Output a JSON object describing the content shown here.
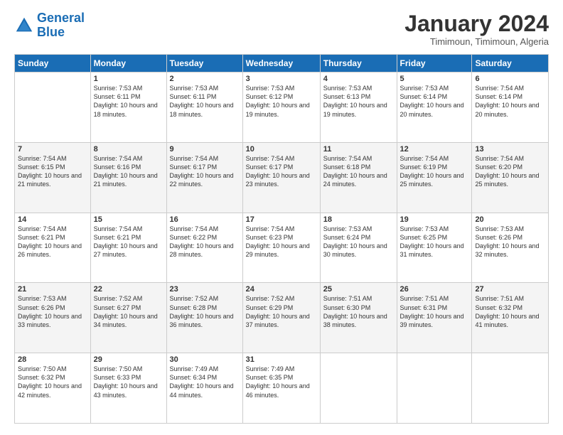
{
  "header": {
    "logo_line1": "General",
    "logo_line2": "Blue",
    "month_title": "January 2024",
    "subtitle": "Timimoun, Timimoun, Algeria"
  },
  "days_of_week": [
    "Sunday",
    "Monday",
    "Tuesday",
    "Wednesday",
    "Thursday",
    "Friday",
    "Saturday"
  ],
  "weeks": [
    [
      {
        "num": "",
        "sunrise": "",
        "sunset": "",
        "daylight": "",
        "empty": true
      },
      {
        "num": "1",
        "sunrise": "Sunrise: 7:53 AM",
        "sunset": "Sunset: 6:11 PM",
        "daylight": "Daylight: 10 hours and 18 minutes."
      },
      {
        "num": "2",
        "sunrise": "Sunrise: 7:53 AM",
        "sunset": "Sunset: 6:11 PM",
        "daylight": "Daylight: 10 hours and 18 minutes."
      },
      {
        "num": "3",
        "sunrise": "Sunrise: 7:53 AM",
        "sunset": "Sunset: 6:12 PM",
        "daylight": "Daylight: 10 hours and 19 minutes."
      },
      {
        "num": "4",
        "sunrise": "Sunrise: 7:53 AM",
        "sunset": "Sunset: 6:13 PM",
        "daylight": "Daylight: 10 hours and 19 minutes."
      },
      {
        "num": "5",
        "sunrise": "Sunrise: 7:53 AM",
        "sunset": "Sunset: 6:14 PM",
        "daylight": "Daylight: 10 hours and 20 minutes."
      },
      {
        "num": "6",
        "sunrise": "Sunrise: 7:54 AM",
        "sunset": "Sunset: 6:14 PM",
        "daylight": "Daylight: 10 hours and 20 minutes."
      }
    ],
    [
      {
        "num": "7",
        "sunrise": "Sunrise: 7:54 AM",
        "sunset": "Sunset: 6:15 PM",
        "daylight": "Daylight: 10 hours and 21 minutes."
      },
      {
        "num": "8",
        "sunrise": "Sunrise: 7:54 AM",
        "sunset": "Sunset: 6:16 PM",
        "daylight": "Daylight: 10 hours and 21 minutes."
      },
      {
        "num": "9",
        "sunrise": "Sunrise: 7:54 AM",
        "sunset": "Sunset: 6:17 PM",
        "daylight": "Daylight: 10 hours and 22 minutes."
      },
      {
        "num": "10",
        "sunrise": "Sunrise: 7:54 AM",
        "sunset": "Sunset: 6:17 PM",
        "daylight": "Daylight: 10 hours and 23 minutes."
      },
      {
        "num": "11",
        "sunrise": "Sunrise: 7:54 AM",
        "sunset": "Sunset: 6:18 PM",
        "daylight": "Daylight: 10 hours and 24 minutes."
      },
      {
        "num": "12",
        "sunrise": "Sunrise: 7:54 AM",
        "sunset": "Sunset: 6:19 PM",
        "daylight": "Daylight: 10 hours and 25 minutes."
      },
      {
        "num": "13",
        "sunrise": "Sunrise: 7:54 AM",
        "sunset": "Sunset: 6:20 PM",
        "daylight": "Daylight: 10 hours and 25 minutes."
      }
    ],
    [
      {
        "num": "14",
        "sunrise": "Sunrise: 7:54 AM",
        "sunset": "Sunset: 6:21 PM",
        "daylight": "Daylight: 10 hours and 26 minutes."
      },
      {
        "num": "15",
        "sunrise": "Sunrise: 7:54 AM",
        "sunset": "Sunset: 6:21 PM",
        "daylight": "Daylight: 10 hours and 27 minutes."
      },
      {
        "num": "16",
        "sunrise": "Sunrise: 7:54 AM",
        "sunset": "Sunset: 6:22 PM",
        "daylight": "Daylight: 10 hours and 28 minutes."
      },
      {
        "num": "17",
        "sunrise": "Sunrise: 7:54 AM",
        "sunset": "Sunset: 6:23 PM",
        "daylight": "Daylight: 10 hours and 29 minutes."
      },
      {
        "num": "18",
        "sunrise": "Sunrise: 7:53 AM",
        "sunset": "Sunset: 6:24 PM",
        "daylight": "Daylight: 10 hours and 30 minutes."
      },
      {
        "num": "19",
        "sunrise": "Sunrise: 7:53 AM",
        "sunset": "Sunset: 6:25 PM",
        "daylight": "Daylight: 10 hours and 31 minutes."
      },
      {
        "num": "20",
        "sunrise": "Sunrise: 7:53 AM",
        "sunset": "Sunset: 6:26 PM",
        "daylight": "Daylight: 10 hours and 32 minutes."
      }
    ],
    [
      {
        "num": "21",
        "sunrise": "Sunrise: 7:53 AM",
        "sunset": "Sunset: 6:26 PM",
        "daylight": "Daylight: 10 hours and 33 minutes."
      },
      {
        "num": "22",
        "sunrise": "Sunrise: 7:52 AM",
        "sunset": "Sunset: 6:27 PM",
        "daylight": "Daylight: 10 hours and 34 minutes."
      },
      {
        "num": "23",
        "sunrise": "Sunrise: 7:52 AM",
        "sunset": "Sunset: 6:28 PM",
        "daylight": "Daylight: 10 hours and 36 minutes."
      },
      {
        "num": "24",
        "sunrise": "Sunrise: 7:52 AM",
        "sunset": "Sunset: 6:29 PM",
        "daylight": "Daylight: 10 hours and 37 minutes."
      },
      {
        "num": "25",
        "sunrise": "Sunrise: 7:51 AM",
        "sunset": "Sunset: 6:30 PM",
        "daylight": "Daylight: 10 hours and 38 minutes."
      },
      {
        "num": "26",
        "sunrise": "Sunrise: 7:51 AM",
        "sunset": "Sunset: 6:31 PM",
        "daylight": "Daylight: 10 hours and 39 minutes."
      },
      {
        "num": "27",
        "sunrise": "Sunrise: 7:51 AM",
        "sunset": "Sunset: 6:32 PM",
        "daylight": "Daylight: 10 hours and 41 minutes."
      }
    ],
    [
      {
        "num": "28",
        "sunrise": "Sunrise: 7:50 AM",
        "sunset": "Sunset: 6:32 PM",
        "daylight": "Daylight: 10 hours and 42 minutes."
      },
      {
        "num": "29",
        "sunrise": "Sunrise: 7:50 AM",
        "sunset": "Sunset: 6:33 PM",
        "daylight": "Daylight: 10 hours and 43 minutes."
      },
      {
        "num": "30",
        "sunrise": "Sunrise: 7:49 AM",
        "sunset": "Sunset: 6:34 PM",
        "daylight": "Daylight: 10 hours and 44 minutes."
      },
      {
        "num": "31",
        "sunrise": "Sunrise: 7:49 AM",
        "sunset": "Sunset: 6:35 PM",
        "daylight": "Daylight: 10 hours and 46 minutes."
      },
      {
        "num": "",
        "sunrise": "",
        "sunset": "",
        "daylight": "",
        "empty": true
      },
      {
        "num": "",
        "sunrise": "",
        "sunset": "",
        "daylight": "",
        "empty": true
      },
      {
        "num": "",
        "sunrise": "",
        "sunset": "",
        "daylight": "",
        "empty": true
      }
    ]
  ]
}
